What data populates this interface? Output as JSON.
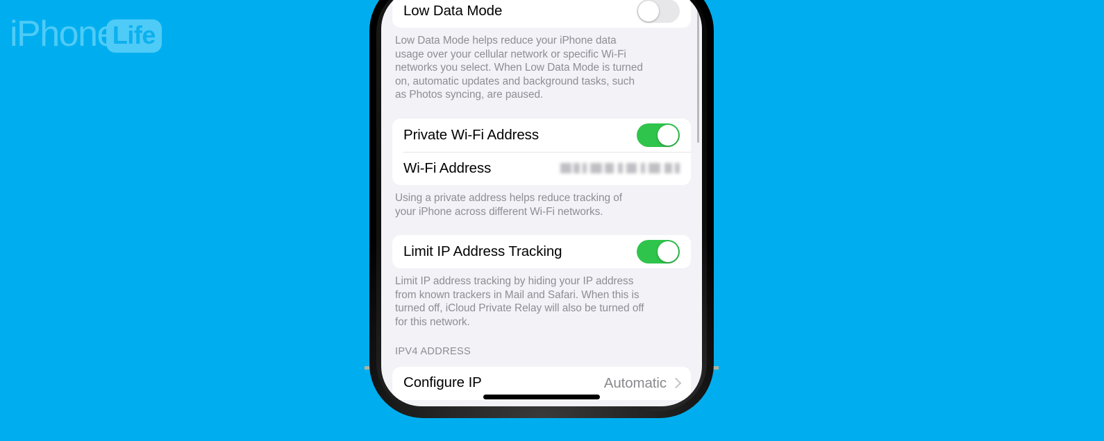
{
  "branding": {
    "logo_word": "iPhone",
    "logo_badge": "Life",
    "background_color": "#00AEEF",
    "logo_color": "#4ECBF7"
  },
  "device": {
    "frame_color": "#b79a72",
    "bezel_color": "#000000",
    "screen_background": "#F2F2F7"
  },
  "screen": {
    "accent_on_color": "#2FC44B",
    "toggle_off_color": "#E7E7E9",
    "sections": [
      {
        "id": "low-data-mode",
        "rows": [
          {
            "label": "Low Data Mode",
            "control": "toggle",
            "state": "off"
          }
        ],
        "footnote": "Low Data Mode helps reduce your iPhone data usage over your cellular network or specific Wi-Fi networks you select. When Low Data Mode is turned on, automatic updates and background tasks, such as Photos syncing, are paused."
      },
      {
        "id": "private-wifi-address",
        "rows": [
          {
            "label": "Private Wi-Fi Address",
            "control": "toggle",
            "state": "on"
          },
          {
            "label": "Wi-Fi Address",
            "control": "redacted-value",
            "value": ""
          }
        ],
        "footnote": "Using a private address helps reduce tracking of your iPhone across different Wi-Fi networks."
      },
      {
        "id": "limit-ip-address-tracking",
        "rows": [
          {
            "label": "Limit IP Address Tracking",
            "control": "toggle",
            "state": "on"
          }
        ],
        "footnote": "Limit IP address tracking by hiding your IP address from known trackers in Mail and Safari. When this is turned off, iCloud Private Relay will also be turned off for this network."
      },
      {
        "id": "ipv4-address",
        "header": "IPV4 ADDRESS",
        "rows": [
          {
            "label": "Configure IP",
            "control": "disclosure",
            "value": "Automatic"
          }
        ]
      }
    ]
  }
}
